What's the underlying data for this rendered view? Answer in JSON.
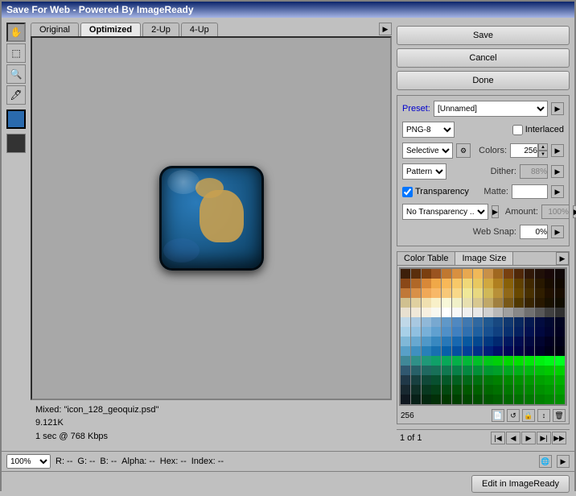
{
  "window": {
    "title": "Save For Web - Powered By ImageReady"
  },
  "tabs": [
    "Original",
    "Optimized",
    "2-Up",
    "4-Up"
  ],
  "active_tab": "Optimized",
  "buttons": {
    "save": "Save",
    "cancel": "Cancel",
    "done": "Done",
    "edit": "Edit in ImageReady"
  },
  "preset": {
    "label": "Preset:",
    "value": "[Unnamed]"
  },
  "format": {
    "value": "PNG-8"
  },
  "color_reduction": {
    "value": "Selective"
  },
  "dither_method": {
    "value": "Pattern"
  },
  "interlaced": {
    "label": "Interlaced",
    "checked": false
  },
  "colors": {
    "label": "Colors:",
    "value": "256"
  },
  "dither": {
    "label": "Dither:",
    "value": "88%"
  },
  "transparency": {
    "label": "Transparency",
    "checked": true
  },
  "matte": {
    "label": "Matte:"
  },
  "no_transparency": {
    "value": "No Transparency .."
  },
  "amount": {
    "label": "Amount:",
    "value": "100%"
  },
  "web_snap": {
    "label": "Web Snap:",
    "value": "0%"
  },
  "color_table": {
    "tab": "Color Table",
    "image_size_tab": "Image Size",
    "count": "256",
    "pagination": "1 of 1"
  },
  "canvas_info": {
    "filename": "Mixed: \"icon_128_geoquiz.psd\"",
    "size": "9.121K",
    "speed": "1 sec @ 768 Kbps"
  },
  "zoom": {
    "value": "100%"
  },
  "status": {
    "r": "R: --",
    "g": "G: --",
    "b": "B: --",
    "alpha": "Alpha: --",
    "hex": "Hex: --",
    "index": "Index: --"
  },
  "colors_grid": [
    "#3d1f0a",
    "#5a2e0c",
    "#7a3f10",
    "#9a5420",
    "#c07830",
    "#d89040",
    "#e8a850",
    "#f0b858",
    "#c89048",
    "#a06820",
    "#784010",
    "#502808",
    "#301808",
    "#201008",
    "#180808",
    "#100808",
    "#8a4818",
    "#b06828",
    "#d88838",
    "#f0a848",
    "#f8b858",
    "#f8c868",
    "#f0d878",
    "#e8c860",
    "#d0a840",
    "#b08020",
    "#886008",
    "#604000",
    "#402800",
    "#281800",
    "#180c00",
    "#100800",
    "#c07838",
    "#d89048",
    "#f0a858",
    "#f8b868",
    "#f8c878",
    "#f8d888",
    "#f0e898",
    "#e8d880",
    "#d0b858",
    "#b89038",
    "#906818",
    "#684800",
    "#483000",
    "#301e00",
    "#201000",
    "#180c00",
    "#d0c090",
    "#e0d0a0",
    "#f0e0b0",
    "#f8f0c8",
    "#f8f8d8",
    "#f0f0c8",
    "#e8e0b0",
    "#d8c890",
    "#c0a868",
    "#a08040",
    "#785818",
    "#503800",
    "#382400",
    "#281800",
    "#181000",
    "#100c00",
    "#e8e0d0",
    "#f0e8d8",
    "#f8f0e0",
    "#f8f8f0",
    "#ffffff",
    "#f8f8f8",
    "#f0f0f0",
    "#e8e8e8",
    "#d0d0d0",
    "#b8b8b8",
    "#a0a0a0",
    "#888888",
    "#707070",
    "#585858",
    "#404040",
    "#303030",
    "#c0d8e8",
    "#a8c8e0",
    "#90b8d8",
    "#78a8d0",
    "#6098c8",
    "#5088c0",
    "#4078b0",
    "#3068a0",
    "#205890",
    "#184880",
    "#103870",
    "#082860",
    "#041850",
    "#020c40",
    "#010830",
    "#010420",
    "#a8d0e8",
    "#90c0e0",
    "#78b0d8",
    "#60a0d0",
    "#5090c8",
    "#4080c0",
    "#3070b0",
    "#2060a0",
    "#185090",
    "#104080",
    "#083070",
    "#042060",
    "#021050",
    "#010840",
    "#010430",
    "#010020",
    "#80b8d8",
    "#68a8d0",
    "#5098c8",
    "#3888c0",
    "#2878b8",
    "#1868b0",
    "#0858a0",
    "#044890",
    "#023880",
    "#012870",
    "#011860",
    "#010c50",
    "#010840",
    "#010430",
    "#010020",
    "#000018",
    "#58a0c8",
    "#4090c0",
    "#2880b8",
    "#1870b0",
    "#0860a8",
    "#0450a0",
    "#024098",
    "#013088",
    "#012078",
    "#011068",
    "#010858",
    "#010448",
    "#010038",
    "#000028",
    "#000018",
    "#000010",
    "#408898",
    "#309088",
    "#209878",
    "#10a068",
    "#08a858",
    "#04b048",
    "#02b838",
    "#00c028",
    "#00c818",
    "#00d008",
    "#00d800",
    "#00e000",
    "#00e808",
    "#00f010",
    "#00f818",
    "#00ff20",
    "#305870",
    "#286068",
    "#206860",
    "#187058",
    "#107850",
    "#088048",
    "#048840",
    "#029038",
    "#009830",
    "#00a028",
    "#00a820",
    "#00b018",
    "#00b810",
    "#00c008",
    "#00c800",
    "#00d000",
    "#203848",
    "#184040",
    "#104838",
    "#085030",
    "#045828",
    "#026020",
    "#016818",
    "#007010",
    "#007808",
    "#008000",
    "#008800",
    "#009000",
    "#009800",
    "#00a000",
    "#00a800",
    "#00b000",
    "#182830",
    "#103028",
    "#083820",
    "#044018",
    "#024810",
    "#015008",
    "#005800",
    "#006000",
    "#006800",
    "#007000",
    "#007800",
    "#008000",
    "#008800",
    "#009000",
    "#009800",
    "#00a000",
    "#101820",
    "#082018",
    "#042810",
    "#023008",
    "#013800",
    "#004000",
    "#004800",
    "#005000",
    "#005800",
    "#006000",
    "#006800",
    "#007000",
    "#007800",
    "#008000",
    "#008800",
    "#009000"
  ]
}
